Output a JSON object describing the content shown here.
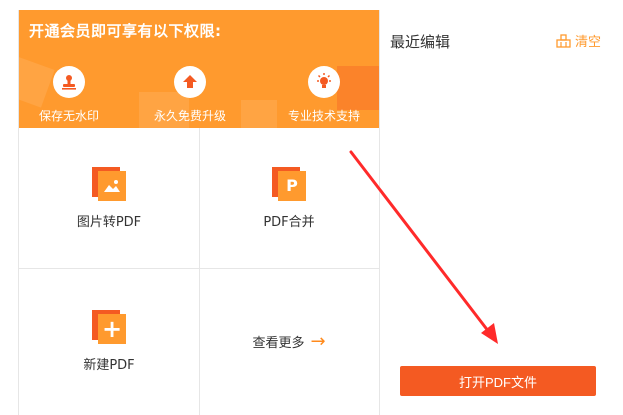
{
  "vip": {
    "title": "开通会员即可享有以下权限:",
    "benefits": [
      {
        "icon": "stamp-icon",
        "label": "保存无水印"
      },
      {
        "icon": "upgrade-arrow-icon",
        "label": "永久免费升级"
      },
      {
        "icon": "lightbulb-icon",
        "label": "专业技术支持"
      }
    ]
  },
  "tools": [
    {
      "icon": "image-to-pdf-icon",
      "label": "图片转PDF"
    },
    {
      "icon": "pdf-merge-icon",
      "label": "PDF合并",
      "glyph": "P"
    },
    {
      "icon": "new-pdf-icon",
      "label": "新建PDF",
      "glyph": "+"
    },
    {
      "icon": "arrow-right-icon",
      "label": "查看更多",
      "glyph": "→"
    }
  ],
  "recent": {
    "title": "最近编辑",
    "clear_label": "清空"
  },
  "actions": {
    "open_label": "打开PDF文件"
  },
  "colors": {
    "brand_orange": "#ff9a2e",
    "accent_red": "#f45a22",
    "annotation_red": "#ff2a2a"
  }
}
